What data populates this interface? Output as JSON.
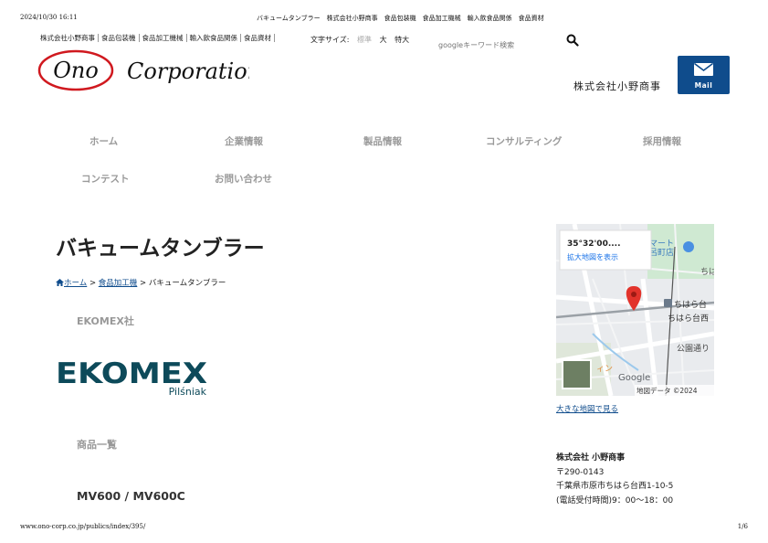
{
  "print_header": {
    "datetime": "2024/10/30 16:11",
    "title": "バキュームタンブラー　株式会社小野商事　食品包装機　食品加工機械　輸入飲食品関係　食品資材"
  },
  "print_footer": {
    "url": "www.ono-corp.co.jp/publics/index/395/",
    "page": "1/6"
  },
  "top_links": [
    "株式会社小野商事",
    "食品包装機",
    "食品加工機械",
    "輸入飲食品関係",
    "食品資材"
  ],
  "font_size": {
    "label": "文字サイズ:",
    "options": [
      "標準",
      "大",
      "特大"
    ]
  },
  "search": {
    "placeholder": "googleキーワード検索"
  },
  "logo": {
    "mark": "Ono",
    "word": "Corporation"
  },
  "company_name_jp": "株式会社小野商事",
  "mail_button": {
    "label": "Mail"
  },
  "nav": [
    "ホーム",
    "企業情報",
    "製品情報",
    "コンサルティング",
    "採用情報",
    "コンテスト",
    "お問い合わせ"
  ],
  "page_title": "バキュームタンブラー",
  "breadcrumb": {
    "home": "ホーム",
    "sep": ">",
    "parent": "食品加工機",
    "current": "バキュームタンブラー"
  },
  "maker": "EKOMEX社",
  "brand_logo": {
    "name": "EKOMEX",
    "sub": "Pilśniak"
  },
  "product_list_heading": "商品一覧",
  "product_name": "MV600 / MV600C",
  "map": {
    "coords": "35°32'00....",
    "enlarge": "拡大地図を表示",
    "labels": [
      "マート",
      "呂町店",
      "ちは",
      "ちはら台",
      "ちはら台西",
      "公園通り",
      "ィン",
      "Google",
      "地図データ ©2024"
    ],
    "view_larger": "大きな地図で見る"
  },
  "address": {
    "company": "株式会社 小野商事",
    "postal": "〒290-0143",
    "street": "千葉県市原市ちはら台西1-10-5",
    "hours": "(電話受付時間)9：00〜18：00"
  },
  "colors": {
    "brand_blue": "#0f4c8c",
    "logo_red": "#d0191f",
    "nav_gray": "#9a9a9a",
    "ekomex_teal": "#0d4a5a"
  }
}
